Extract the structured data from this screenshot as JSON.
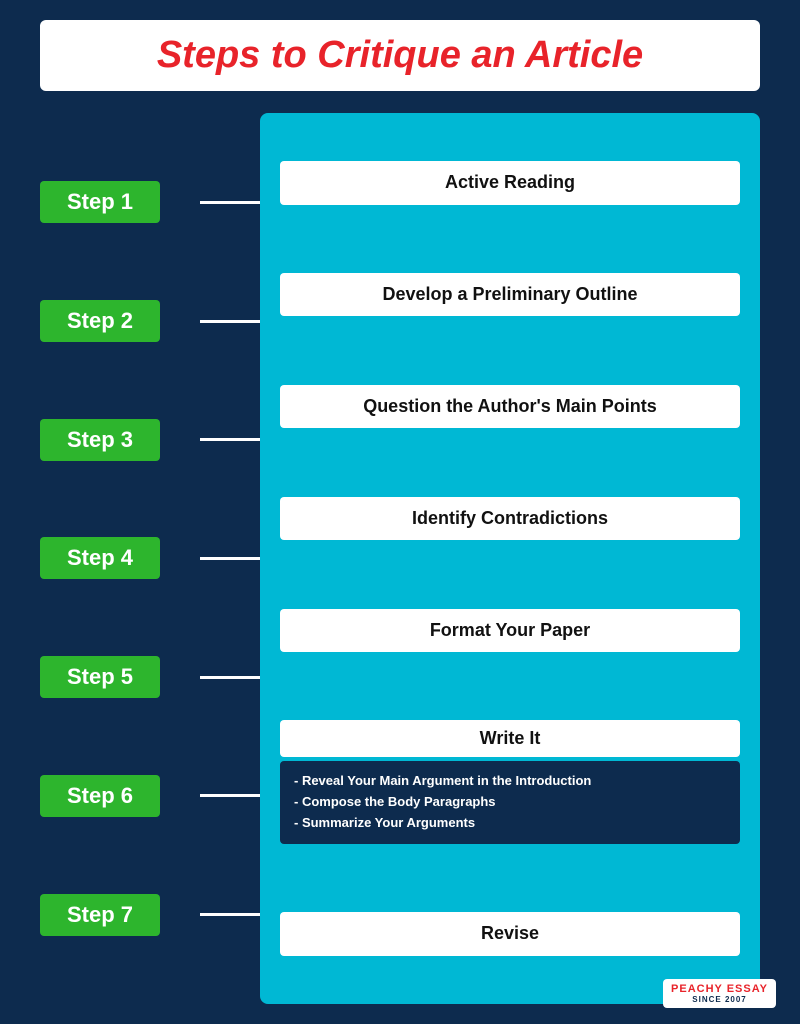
{
  "title": "Steps to Critique an Article",
  "steps": [
    {
      "label": "Step 1"
    },
    {
      "label": "Step 2"
    },
    {
      "label": "Step 3"
    },
    {
      "label": "Step 4"
    },
    {
      "label": "Step 5"
    },
    {
      "label": "Step 6"
    },
    {
      "label": "Step 7"
    }
  ],
  "cards": [
    {
      "id": "card1",
      "text": "Active Reading"
    },
    {
      "id": "card2",
      "text": "Develop a Preliminary Outline"
    },
    {
      "id": "card3",
      "text": "Question the Author's Main Points"
    },
    {
      "id": "card4",
      "text": "Identify Contradictions"
    },
    {
      "id": "card5",
      "text": "Format Your Paper"
    },
    {
      "id": "card6_main",
      "text": "Write It"
    },
    {
      "id": "card6_sub1",
      "text": "- Reveal Your Main Argument in the Introduction"
    },
    {
      "id": "card6_sub2",
      "text": "- Compose the Body Paragraphs"
    },
    {
      "id": "card6_sub3",
      "text": "- Summarize Your Arguments"
    },
    {
      "id": "card7",
      "text": "Revise"
    }
  ],
  "logo": {
    "top": "PEACHY ESSAY",
    "bottom": "SINCE 2007"
  }
}
